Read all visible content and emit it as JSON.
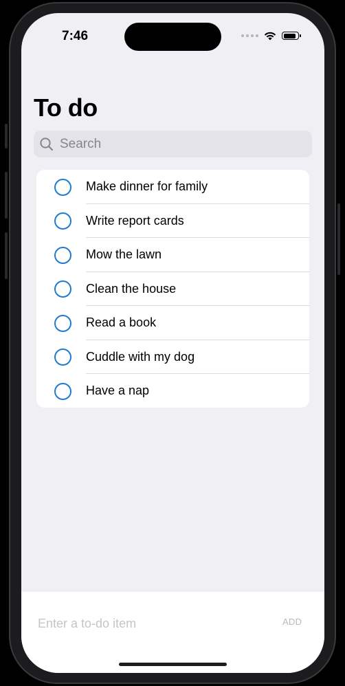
{
  "status_bar": {
    "time": "7:46",
    "battery_level": 0.85,
    "icons": [
      "cellular-icon",
      "wifi-icon",
      "battery-icon"
    ]
  },
  "page": {
    "title": "To do"
  },
  "search": {
    "placeholder": "Search",
    "icon": "search-icon"
  },
  "todos": [
    {
      "label": "Make dinner for family",
      "done": false
    },
    {
      "label": "Write report cards",
      "done": false
    },
    {
      "label": "Mow the lawn",
      "done": false
    },
    {
      "label": "Clean the house",
      "done": false
    },
    {
      "label": "Read a book",
      "done": false
    },
    {
      "label": "Cuddle with my dog",
      "done": false
    },
    {
      "label": "Have a nap",
      "done": false
    }
  ],
  "composer": {
    "placeholder": "Enter a to-do item",
    "add_label": "ADD"
  },
  "colors": {
    "accent": "#1f7ad0",
    "background": "#f0eff4",
    "card": "#ffffff",
    "search_bg": "#e3e3e9"
  }
}
